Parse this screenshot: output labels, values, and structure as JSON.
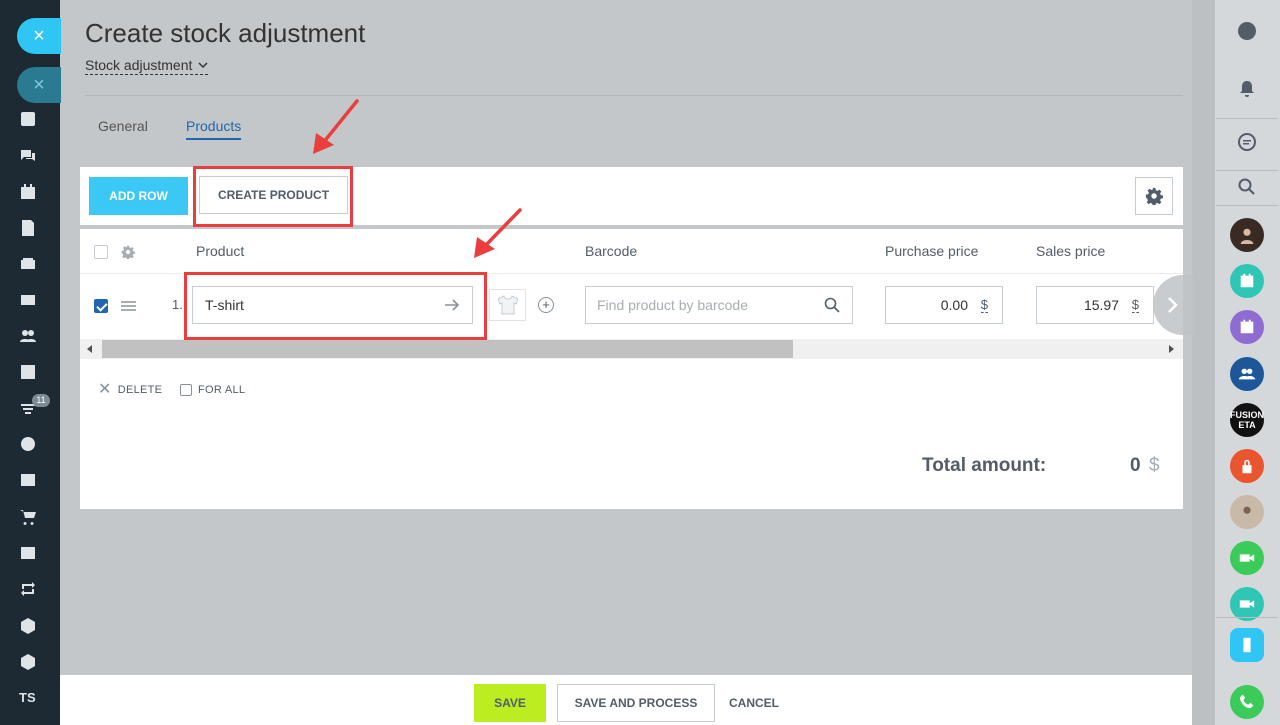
{
  "page": {
    "title": "Create stock adjustment",
    "document_type": "Stock adjustment"
  },
  "tabs": [
    {
      "label": "General",
      "active": false
    },
    {
      "label": "Products",
      "active": true
    }
  ],
  "toolbar": {
    "add_row_label": "ADD ROW",
    "create_product_label": "CREATE PRODUCT"
  },
  "grid": {
    "columns": {
      "product": "Product",
      "barcode": "Barcode",
      "purchase_price": "Purchase price",
      "sales_price": "Sales price"
    },
    "rows": [
      {
        "checked": true,
        "number": "1.",
        "product": "T-shirt",
        "barcode_placeholder": "Find product by barcode",
        "purchase_price": "0.00",
        "purchase_currency": "$",
        "sales_price": "15.97",
        "sales_currency": "$"
      }
    ],
    "actions": {
      "delete_label": "DELETE",
      "for_all_label": "FOR ALL"
    },
    "total": {
      "label": "Total amount:",
      "value": "0",
      "currency": "$"
    }
  },
  "footer": {
    "save_label": "SAVE",
    "save_process_label": "SAVE AND PROCESS",
    "cancel_label": "CANCEL"
  },
  "sidebar_left": {
    "close_symbol": "×",
    "counter_badge": "11",
    "user_initials": "TS"
  },
  "sidebar_right": {
    "avatar_text": "FUSION ETA"
  },
  "colors": {
    "accent_blue": "#3bc8f5",
    "save_green": "#bbed21",
    "annotation_red": "#ea3e3e",
    "link_blue": "#2067b0"
  }
}
